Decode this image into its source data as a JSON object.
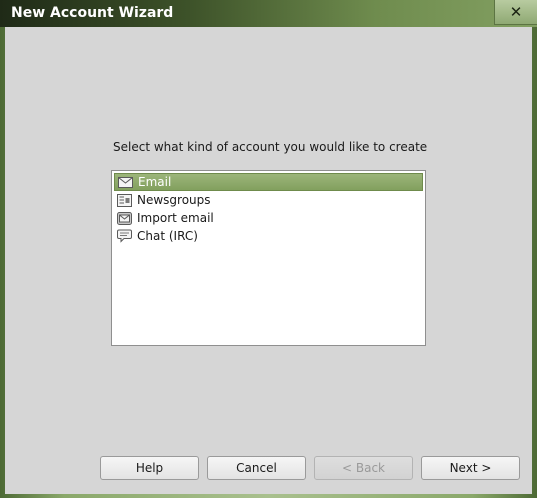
{
  "window": {
    "title": "New Account Wizard",
    "close_glyph": "✕"
  },
  "prompt": "Select what kind of account you would like to create",
  "account_types": [
    {
      "label": "Email",
      "icon": "envelope-icon",
      "selected": true
    },
    {
      "label": "Newsgroups",
      "icon": "newsgroup-icon",
      "selected": false
    },
    {
      "label": "Import email",
      "icon": "import-icon",
      "selected": false
    },
    {
      "label": "Chat (IRC)",
      "icon": "chat-bubble-icon",
      "selected": false
    }
  ],
  "buttons": {
    "help": "Help",
    "cancel": "Cancel",
    "back": "< Back",
    "next": "Next >"
  },
  "colors": {
    "selection": "#8aa766",
    "client_bg": "#d6d6d6",
    "titlebar_accent": "#83a062"
  }
}
